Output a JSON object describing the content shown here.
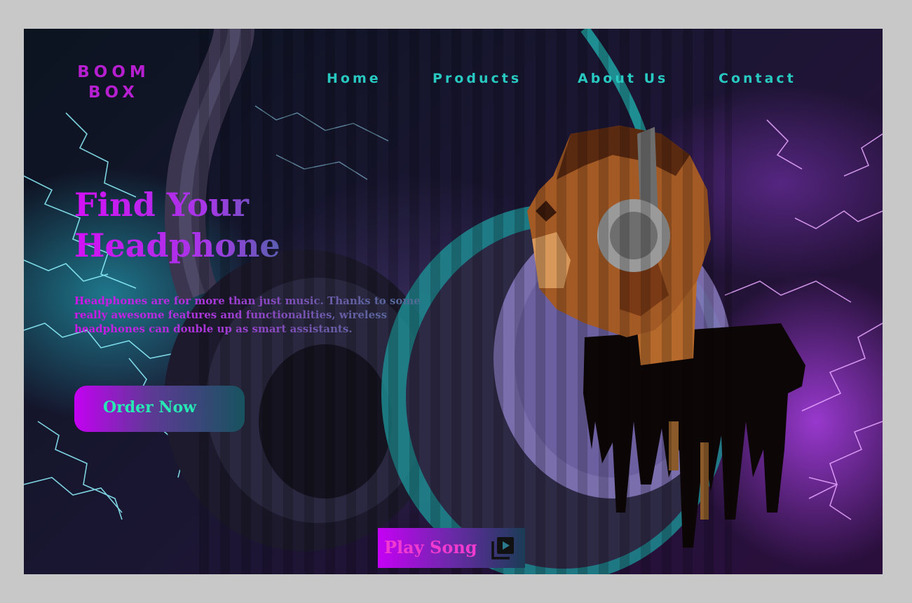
{
  "brand": {
    "line1": "BOOM",
    "line2": "BOX"
  },
  "nav": {
    "items": [
      {
        "label": "Home"
      },
      {
        "label": "Products"
      },
      {
        "label": "About Us"
      },
      {
        "label": "Contact"
      }
    ]
  },
  "hero": {
    "title_line1": "Find Your",
    "title_line2": "Headphone",
    "description": "Headphones are for more than just music. Thanks to some really awesome features and functionalities, wireless headphones can double up as smart assistants.",
    "order_label": "Order Now"
  },
  "player": {
    "play_label": "Play Song",
    "icon": "playlist-play-icon"
  },
  "colors": {
    "brand_magenta": "#b51fd0",
    "nav_teal": "#28c9c0",
    "button_text_green": "#27e7b4",
    "play_text_pink": "#f03ad0"
  }
}
